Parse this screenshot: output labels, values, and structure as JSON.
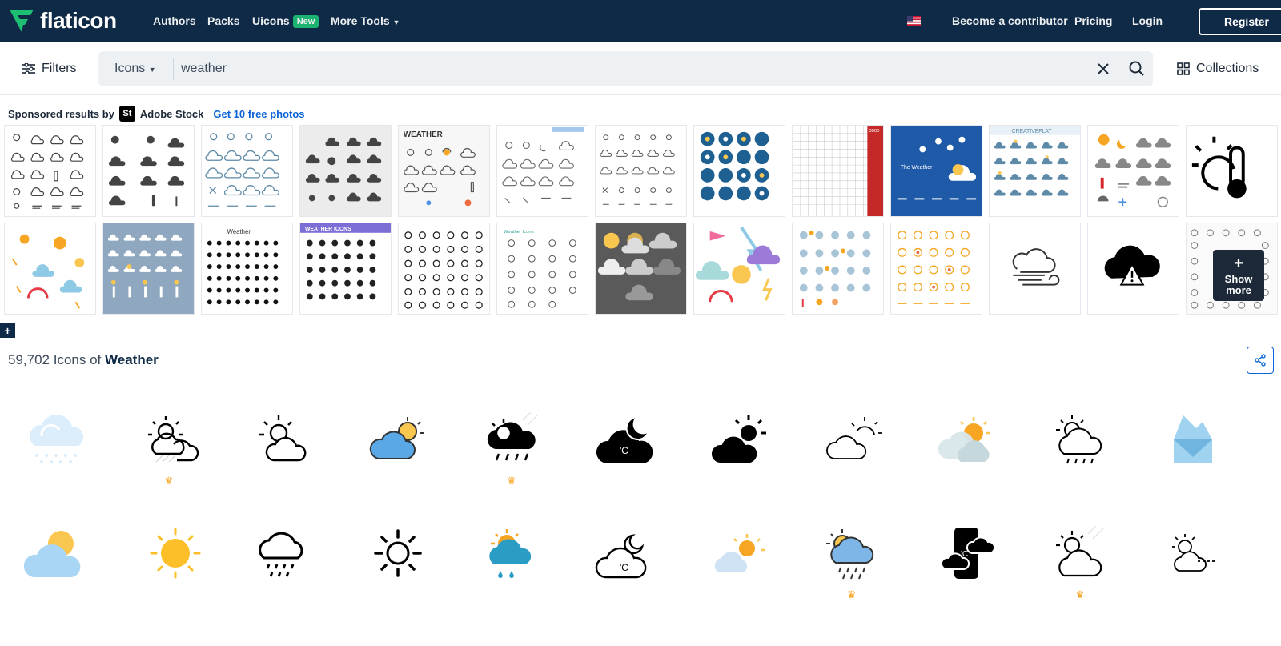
{
  "nav": {
    "logo_text": "flaticon",
    "links": [
      "Authors",
      "Packs",
      "Uicons",
      "More Tools"
    ],
    "new_badge": "New",
    "contributor": "Become a contributor",
    "pricing": "Pricing",
    "login": "Login",
    "register": "Register",
    "colors": {
      "bg": "#0e2a47",
      "accent": "#1dbf73"
    }
  },
  "search": {
    "filters_label": "Filters",
    "type_label": "Icons",
    "query": "weather",
    "collections_label": "Collections"
  },
  "sponsored": {
    "prefix": "Sponsored results by",
    "badge": "St",
    "brand": "Adobe Stock",
    "link": "Get 10 free photos"
  },
  "show_more": {
    "plus": "+",
    "label": "Show more"
  },
  "results": {
    "count": "59,702",
    "middle": "Icons of",
    "term": "Weather"
  },
  "expand_plus": "+",
  "premium_icon": "crown-icon"
}
